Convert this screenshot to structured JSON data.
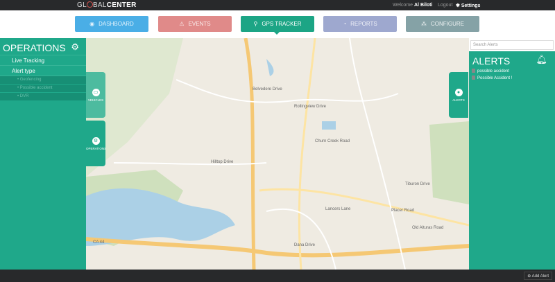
{
  "header": {
    "logo_prefix": "GL",
    "logo_mid": "BAL",
    "logo_bold": "CENTER",
    "welcome": "Welcome",
    "user": "Al Biloti",
    "logout": "Logout",
    "settings": "Settings"
  },
  "nav": [
    {
      "label": "DASHBOARD",
      "color": "#4aaee6",
      "icon": "dashboard-icon",
      "glyph": "◉"
    },
    {
      "label": "EVENTS",
      "color": "#e08a89",
      "icon": "warning-icon",
      "glyph": "⚠"
    },
    {
      "label": "GPS TRACKER",
      "color": "#1ca585",
      "icon": "map-pin-icon",
      "glyph": "⚲"
    },
    {
      "label": "REPORTS",
      "color": "#9ea8cf",
      "icon": "pie-chart-icon",
      "glyph": "◔"
    },
    {
      "label": "CONFIGURE",
      "color": "#85a2a6",
      "icon": "sitemap-icon",
      "glyph": "⁂"
    }
  ],
  "sidebar": {
    "title": "OPERATIONS",
    "items": [
      {
        "label": "Live Tracking"
      },
      {
        "label": "Alert type"
      }
    ],
    "subitems": [
      {
        "label": "• Geofencing"
      },
      {
        "label": "• Possible accident"
      },
      {
        "label": "• DVR"
      }
    ]
  },
  "tabs": {
    "vehicles": "VEHICLES",
    "operations": "OPERATIONS",
    "alerts": "ALERTS"
  },
  "alerts": {
    "search_placeholder": "Search Alerts",
    "title": "ALERTS",
    "items": [
      {
        "label": "possible accident"
      },
      {
        "label": "Possible Accident !"
      }
    ]
  },
  "footer": {
    "add_alert": "Add Alert"
  },
  "map": {
    "labels": [
      "Belvedere Drive",
      "Rollingview Drive",
      "Hilltop Drive",
      "Dana Drive",
      "CA 44",
      "Churn Creek Road",
      "Tiburon Drive",
      "Old Alturas Road",
      "Lancers Lane",
      "Placer Road"
    ]
  }
}
